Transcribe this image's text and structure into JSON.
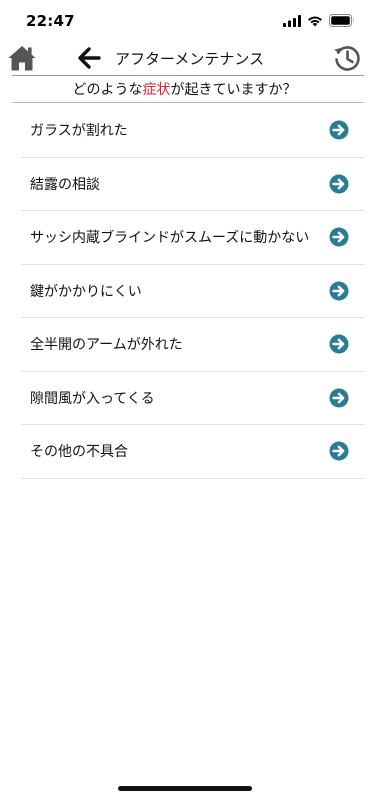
{
  "status_bar": {
    "time": "22:47"
  },
  "header": {
    "title": "アフターメンテナンス",
    "home_icon": "home-icon",
    "back_icon": "arrow-left-icon",
    "history_icon": "history-icon"
  },
  "question": {
    "prefix": "どのような",
    "highlight": "症状",
    "suffix": "が起きていますか？",
    "highlight_color": "#e5232b"
  },
  "symptoms": [
    {
      "label": "ガラスが割れた"
    },
    {
      "label": "結露の相談"
    },
    {
      "label": "サッシ内蔵ブラインドがスムーズに動かない"
    },
    {
      "label": "鍵がかかりにくい"
    },
    {
      "label": "全半開のアームが外れた"
    },
    {
      "label": "隙間風が入ってくる"
    },
    {
      "label": "その他の不具合"
    }
  ],
  "colors": {
    "arrow_accent": "#2b7a96",
    "icon_gray": "#555555"
  }
}
